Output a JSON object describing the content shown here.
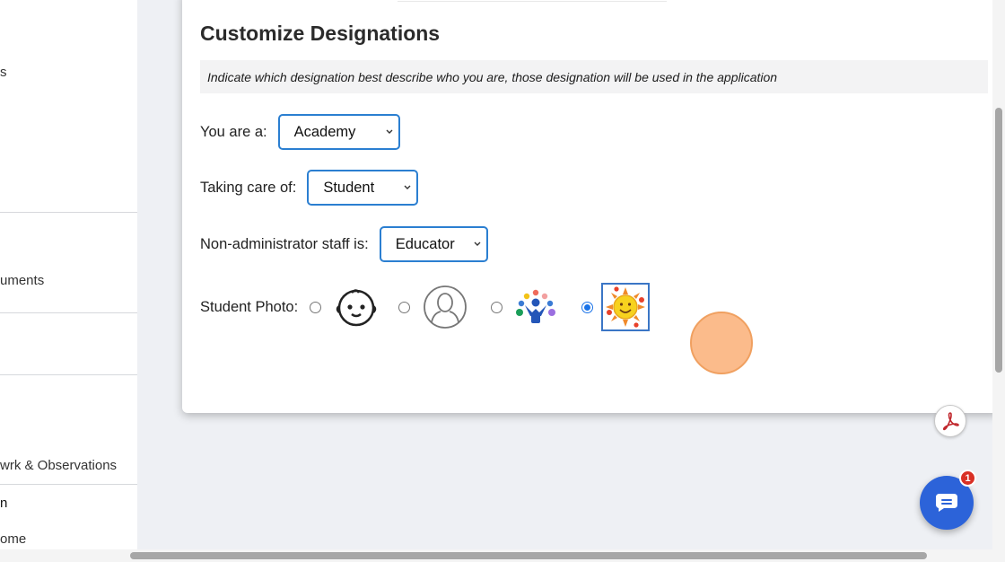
{
  "sidebar": {
    "items": [
      {
        "label": "s"
      },
      {
        "label": "uments"
      },
      {
        "label": "wrk & Observations"
      },
      {
        "label": "n"
      },
      {
        "label": "ome"
      }
    ]
  },
  "card": {
    "title": "Customize Designations",
    "hint": "Indicate which designation best describe who you are, those designation will be used in the application",
    "fields": {
      "you_are": {
        "label": "You are a:",
        "value": "Academy"
      },
      "taking_care": {
        "label": "Taking care of:",
        "value": "Student"
      },
      "staff": {
        "label": "Non-administrator staff is:",
        "value": "Educator"
      }
    },
    "photo": {
      "label": "Student Photo:",
      "options": [
        {
          "icon": "baby-face-icon",
          "selected": false
        },
        {
          "icon": "person-silhouette-icon",
          "selected": false
        },
        {
          "icon": "group-people-icon",
          "selected": false
        },
        {
          "icon": "sun-handprint-icon",
          "selected": true
        }
      ]
    }
  },
  "chat": {
    "badge_count": "1"
  },
  "colors": {
    "accent": "#2b7fd1",
    "chat": "#2c63d9",
    "badge": "#d93025",
    "pdf": "#c0262c"
  }
}
